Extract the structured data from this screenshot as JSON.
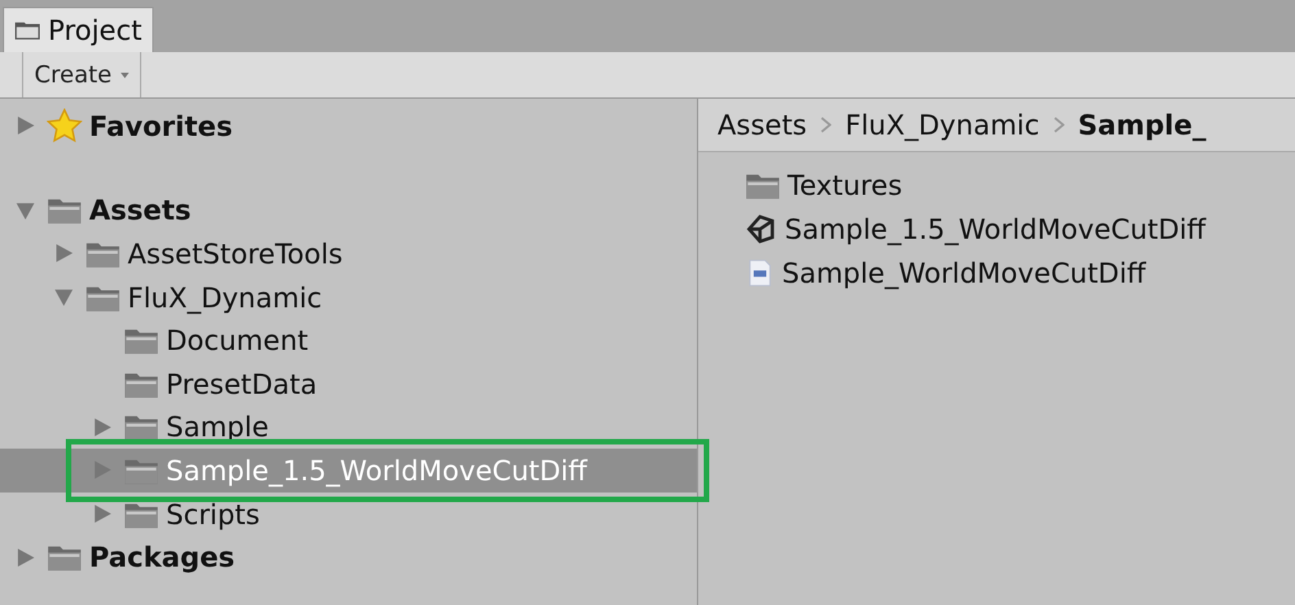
{
  "tab": {
    "label": "Project",
    "selected": true
  },
  "toolbar": {
    "create_button": "Create"
  },
  "tree": [
    {
      "label": "Favorites",
      "kind": "favorites",
      "expanded": false,
      "selected": false,
      "highlighted": false
    },
    {
      "label": "Assets",
      "kind": "folder",
      "expanded": true,
      "selected": false,
      "highlighted": false,
      "children": [
        {
          "label": "AssetStoreTools",
          "kind": "folder",
          "expanded": false,
          "selected": false,
          "highlighted": false
        },
        {
          "label": "FluX_Dynamic",
          "kind": "folder",
          "expanded": true,
          "selected": false,
          "highlighted": false,
          "children": [
            {
              "label": "Document",
              "kind": "folder",
              "selected": false,
              "highlighted": false
            },
            {
              "label": "PresetData",
              "kind": "folder",
              "selected": false,
              "highlighted": false
            },
            {
              "label": "Sample",
              "kind": "folder",
              "expanded": false,
              "selected": false,
              "highlighted": false
            },
            {
              "label": "Sample_1.5_WorldMoveCutDiff",
              "kind": "folder",
              "expanded": false,
              "selected": true,
              "highlighted": true
            },
            {
              "label": "Scripts",
              "kind": "folder",
              "expanded": false,
              "selected": false,
              "highlighted": false
            }
          ]
        }
      ]
    },
    {
      "label": "Packages",
      "kind": "folder",
      "expanded": false,
      "selected": false,
      "highlighted": false
    }
  ],
  "breadcrumb": [
    {
      "label": "Assets",
      "current": false
    },
    {
      "label": "FluX_Dynamic",
      "current": false
    },
    {
      "label": "Sample_",
      "current": true
    }
  ],
  "files": [
    {
      "label": "Textures",
      "kind": "folder"
    },
    {
      "label": "Sample_1.5_WorldMoveCutDiff",
      "kind": "scene"
    },
    {
      "label": "Sample_WorldMoveCutDiff",
      "kind": "script"
    }
  ]
}
